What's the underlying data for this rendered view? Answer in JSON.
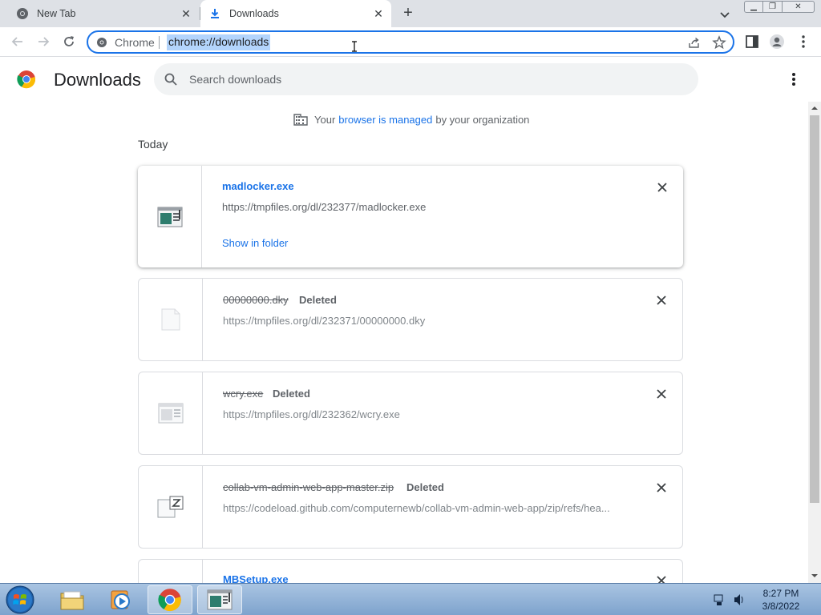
{
  "tabs": [
    {
      "title": "New Tab",
      "active": false
    },
    {
      "title": "Downloads",
      "active": true
    }
  ],
  "window_controls": {
    "minimize": "minimize",
    "maximize": "restore",
    "close": "close"
  },
  "toolbar": {
    "omnibox_chip": "Chrome",
    "url": "chrome://downloads"
  },
  "header": {
    "title": "Downloads",
    "search_placeholder": "Search downloads"
  },
  "managed_notice": {
    "prefix": "Your",
    "link": "browser is managed",
    "suffix": "by your organization"
  },
  "section_date": "Today",
  "downloads": [
    {
      "filename": "madlocker.exe",
      "status": "",
      "url": "https://tmpfiles.org/dl/232377/madlocker.exe",
      "action": "Show in folder",
      "deleted": false,
      "icon": "exe-file-icon"
    },
    {
      "filename": "00000000.dky",
      "status": "Deleted",
      "url": "https://tmpfiles.org/dl/232371/00000000.dky",
      "deleted": true,
      "icon": "blank-file-icon"
    },
    {
      "filename": "wcry.exe",
      "status": "Deleted",
      "url": "https://tmpfiles.org/dl/232362/wcry.exe",
      "deleted": true,
      "icon": "exe-file-icon"
    },
    {
      "filename": "collab-vm-admin-web-app-master.zip",
      "status": "Deleted",
      "url": "https://codeload.github.com/computernewb/collab-vm-admin-web-app/zip/refs/hea...",
      "deleted": true,
      "icon": "zip-file-icon"
    },
    {
      "filename": "MBSetup.exe",
      "status": "",
      "url": "",
      "deleted": false,
      "icon": "exe-file-icon"
    }
  ],
  "taskbar": {
    "time": "8:27 PM",
    "date": "3/8/2022",
    "apps": [
      "windows-explorer",
      "media-player",
      "google-chrome",
      "exe-window"
    ]
  },
  "colors": {
    "accent": "#1a73e8",
    "tabstrip": "#dee1e6",
    "search_bg": "#f1f3f4"
  }
}
